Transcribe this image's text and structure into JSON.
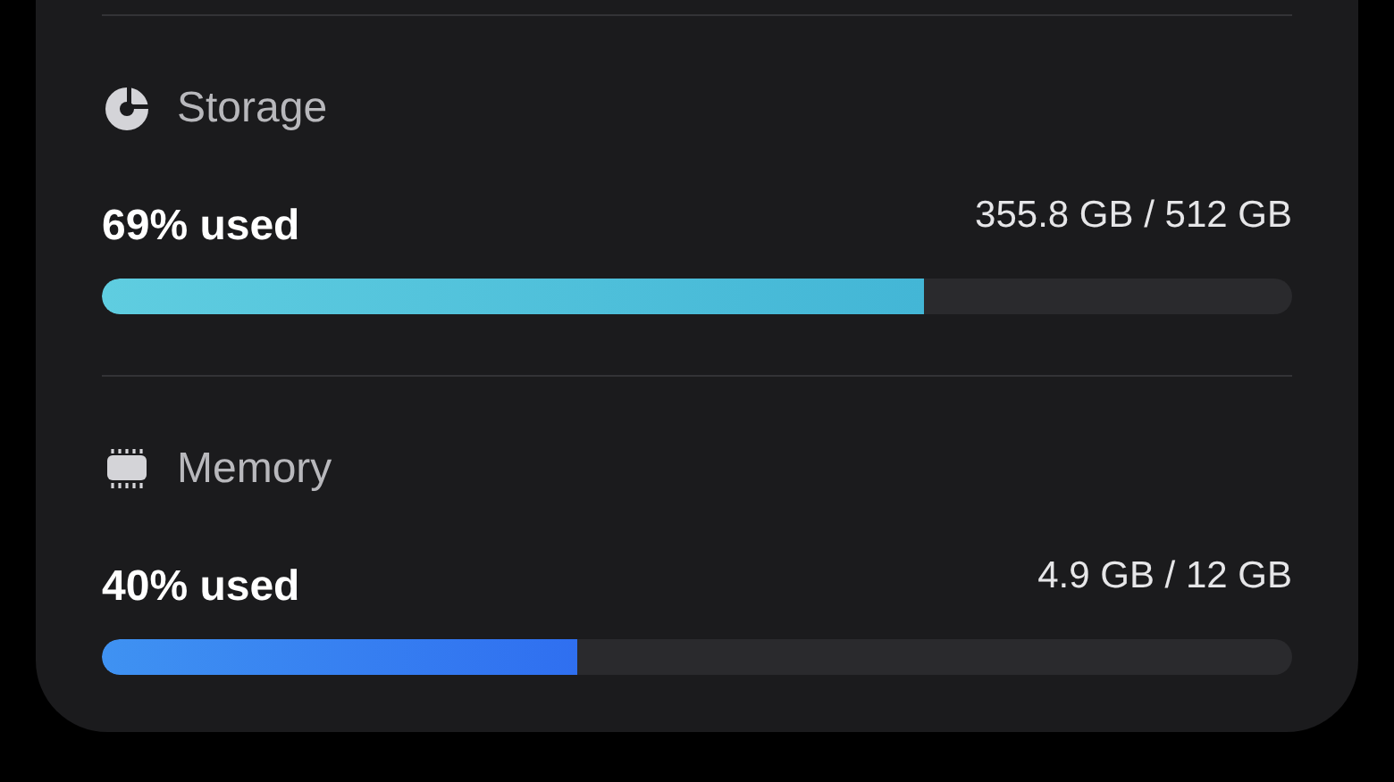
{
  "sections": [
    {
      "kind": "storage",
      "title": "Storage",
      "usage": "69% used",
      "amount": "355.8 GB / 512 GB",
      "level": 0.69
    },
    {
      "kind": "memory",
      "title": "Memory",
      "usage": "40% used",
      "amount": "4.9 GB / 12 GB",
      "level": 0.4
    }
  ]
}
